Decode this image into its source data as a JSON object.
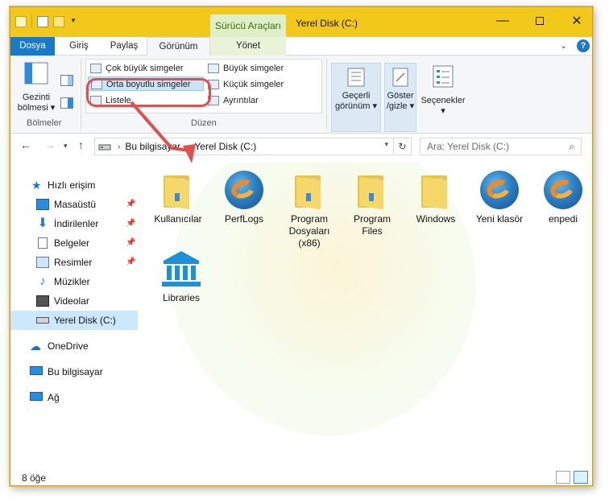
{
  "titlebar": {
    "context_tab_header": "Sürücü Araçları",
    "window_title": "Yerel Disk (C:)",
    "minimize_glyph": "—",
    "close_glyph": "✕"
  },
  "tabs": {
    "file": "Dosya",
    "home": "Giriş",
    "share": "Paylaş",
    "view": "Görünüm",
    "manage": "Yönet",
    "help": "?"
  },
  "ribbon": {
    "panes": {
      "nav_pane_line1": "Gezinti",
      "nav_pane_line2": "bölmesi ▾",
      "group_label": "Bölmeler"
    },
    "layout": {
      "group_label": "Düzen",
      "items": {
        "extra_large": "Çok büyük simgeler",
        "large": "Büyük simgeler",
        "medium": "Orta boyutlu simgeler",
        "small": "Küçük simgeler",
        "list": "Listele",
        "details": "Ayrıntılar"
      },
      "selected": "Orta boyutlu simgeler"
    },
    "current_view": {
      "line1": "Geçerli",
      "line2": "görünüm ▾"
    },
    "show_hide": {
      "line1": "Göster",
      "line2": "/gizle ▾"
    },
    "options": {
      "label": "Seçenekler",
      "arrow": "▾"
    }
  },
  "address": {
    "parts": [
      "Bu bilgisayar",
      "Yerel Disk (C:)"
    ],
    "search_placeholder": "Ara: Yerel Disk (C:)"
  },
  "nav_pane": {
    "quick_access": "Hızlı erişim",
    "items": [
      {
        "label": "Masaüstü",
        "icon": "desktop-icon",
        "pinned": true
      },
      {
        "label": "İndirilenler",
        "icon": "download-icon",
        "pinned": true
      },
      {
        "label": "Belgeler",
        "icon": "documents-icon",
        "pinned": true
      },
      {
        "label": "Resimler",
        "icon": "pictures-icon",
        "pinned": true
      },
      {
        "label": "Müzikler",
        "icon": "music-icon",
        "pinned": false
      },
      {
        "label": "Videolar",
        "icon": "videos-icon",
        "pinned": false
      },
      {
        "label": "Yerel Disk (C:)",
        "icon": "drive-icon",
        "pinned": false,
        "selected": true
      }
    ],
    "onedrive": "OneDrive",
    "this_pc": "Bu bilgisayar",
    "network": "Ağ"
  },
  "files": [
    {
      "name": "Kullanıcılar",
      "type": "folder"
    },
    {
      "name": "PerfLogs",
      "type": "app-orb"
    },
    {
      "name": "Program Dosyaları (x86)",
      "type": "folder"
    },
    {
      "name": "Program Files",
      "type": "folder"
    },
    {
      "name": "Windows",
      "type": "folder"
    },
    {
      "name": "Yeni klasör",
      "type": "app-orb"
    },
    {
      "name": "enpedi",
      "type": "app-orb"
    },
    {
      "name": "Libraries",
      "type": "library"
    }
  ],
  "statusbar": {
    "item_count": "8 öğe"
  },
  "colors": {
    "titlebar": "#f2c81a",
    "file_tab": "#1979ca",
    "callout": "#e05050",
    "selection": "#cce8ff"
  }
}
